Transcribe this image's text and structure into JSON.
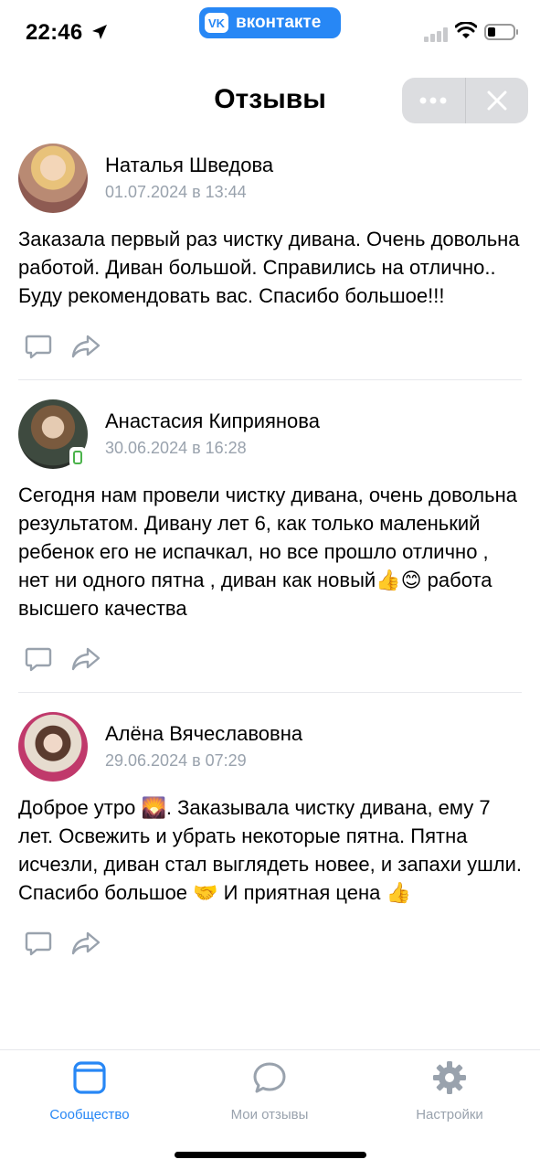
{
  "status_bar": {
    "time": "22:46",
    "app_badge": "вконтакте",
    "vk_logo": "VK",
    "icons": [
      "location-arrow-icon",
      "signal-icon",
      "wifi-icon",
      "battery-icon"
    ]
  },
  "header": {
    "title": "Отзывы",
    "more_icon": "more-horizontal-icon",
    "close_icon": "close-icon"
  },
  "colors": {
    "accent": "#2787f5",
    "secondary_text": "#99a2ad",
    "separator": "#e7e8ec",
    "pill_bg": "#dcdde0",
    "online_badge": "#4bb34b"
  },
  "reviews": [
    {
      "author": "Наталья Шведова",
      "date": "01.07.2024 в 13:44",
      "text": "Заказала первый раз чистку дивана. Очень довольна работой. Диван большой. Справились на отлично.. Буду рекомендовать вас. Спасибо большое!!!"
    },
    {
      "author": "Анастасия Киприянова",
      "date": "30.06.2024 в 16:28",
      "text": "Сегодня нам провели чистку дивана, очень довольна результатом. Дивану лет 6, как только маленький ребенок его не испачкал, но все прошло отлично , нет ни одного пятна , диван как новый👍😊 работа высшего качества"
    },
    {
      "author": "Алёна Вячеславовна",
      "date": "29.06.2024 в 07:29",
      "text": "Доброе утро 🌄. Заказывала чистку дивана, ему 7 лет. Освежить и убрать некоторые пятна. Пятна исчезли, диван стал выглядеть новее, и запахи ушли. Спасибо большое 🤝 И приятная цена 👍"
    }
  ],
  "tabbar": {
    "tabs": [
      {
        "label": "Сообщество",
        "icon": "community-icon",
        "active": true
      },
      {
        "label": "Мои отзывы",
        "icon": "chat-bubble-icon",
        "active": false
      },
      {
        "label": "Настройки",
        "icon": "gear-icon",
        "active": false
      }
    ]
  }
}
